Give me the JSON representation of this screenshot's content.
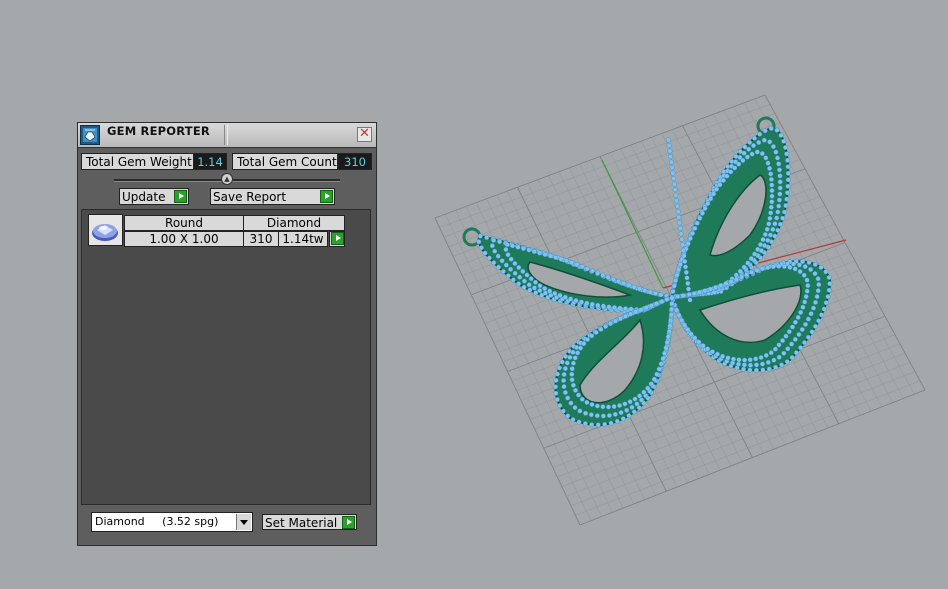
{
  "panel": {
    "title": "GEM REPORTER",
    "total_weight_label": "Total Gem Weight",
    "total_weight_value": "1.14",
    "total_count_label": "Total Gem Count",
    "total_count_value": "310",
    "update_label": "Update",
    "save_report_label": "Save Report",
    "gems": [
      {
        "shape": "Round",
        "material": "Diamond",
        "size": "1.00 X 1.00",
        "count": "310",
        "weight": "1.14tw"
      }
    ],
    "material_select": "Diamond     (3.52 spg)",
    "set_material_label": "Set Material"
  },
  "viewport": {
    "model": "butterfly-pendant",
    "colors": {
      "background": "#a4a8ab",
      "grid": "#8f9496",
      "metal": "#1f7a5a",
      "gems": "#7ec4f0",
      "x_axis": "#b33a3a",
      "y_axis": "#3a9a3a"
    }
  }
}
